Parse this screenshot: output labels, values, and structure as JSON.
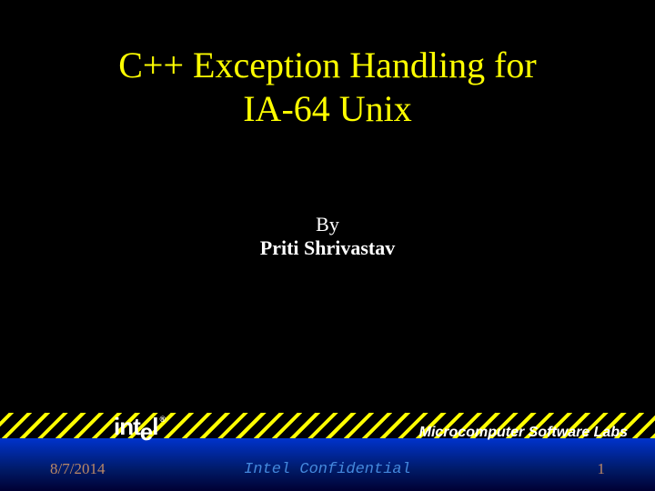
{
  "title": {
    "line1": "C++ Exception Handling for",
    "line2": "IA-64 Unix"
  },
  "byline": {
    "by": "By",
    "author": "Priti Shrivastav"
  },
  "footer": {
    "logo": "intel",
    "lab_name": "Microcomputer Software Labs",
    "date": "8/7/2014",
    "confidential": "Intel Confidential",
    "page_number": "1"
  }
}
